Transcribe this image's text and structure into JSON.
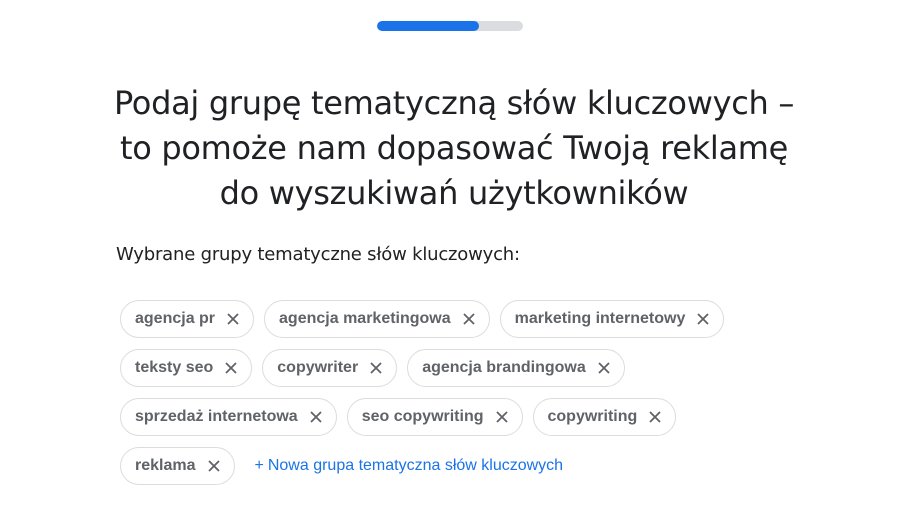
{
  "progress": {
    "fraction": 0.7
  },
  "heading": {
    "lines": [
      "Podaj grupę tematyczną słów kluczowych –",
      "to pomoże nam dopasować Twoją reklamę",
      "do wyszukiwań użytkowników"
    ]
  },
  "selected_label": "Wybrane grupy tematyczne słów kluczowych:",
  "chips": [
    "agencja pr",
    "agencja marketingowa",
    "marketing internetowy",
    "teksty seo",
    "copywriter",
    "agencja brandingowa",
    "sprzedaż internetowa",
    "seo copywriting",
    "copywriting",
    "reklama"
  ],
  "add_link": {
    "plus": "+",
    "label": "Nowa grupa tematyczna słów kluczowych"
  },
  "icons": {
    "remove": "close-icon"
  },
  "colors": {
    "accent": "#1a73e8",
    "track": "#dadce0",
    "chip_text": "#5f6368"
  }
}
